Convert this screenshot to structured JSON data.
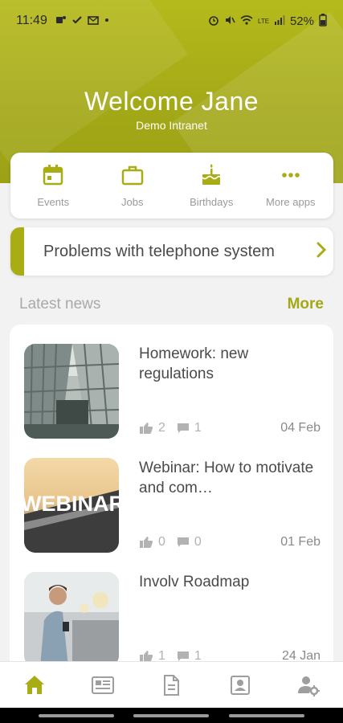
{
  "status_bar": {
    "time": "11:49",
    "battery": "52%",
    "left_icons": [
      "teams-icon",
      "check-icon",
      "outlook-icon",
      "dot-icon"
    ],
    "right_icons": [
      "alarm-icon",
      "mute-icon",
      "wifi-icon",
      "volte-icon",
      "signal-icon",
      "battery-icon"
    ]
  },
  "header": {
    "title": "Welcome Jane",
    "subtitle": "Demo Intranet",
    "accent_color": "#a8ad15"
  },
  "quick_apps": [
    {
      "label": "Events",
      "icon": "calendar-icon"
    },
    {
      "label": "Jobs",
      "icon": "briefcase-icon"
    },
    {
      "label": "Birthdays",
      "icon": "cake-icon"
    },
    {
      "label": "More apps",
      "icon": "more-dots-icon"
    }
  ],
  "banner": {
    "text": "Problems with telephone system",
    "icon": "chevron-right-icon"
  },
  "news_section": {
    "title": "Latest news",
    "more_label": "More"
  },
  "news": [
    {
      "title": "Homework: new regulations",
      "likes": "2",
      "comments": "1",
      "date": "04 Feb",
      "image": "glass-building-photo"
    },
    {
      "title": "Webinar: How to motivate and com…",
      "likes": "0",
      "comments": "0",
      "date": "01 Feb",
      "image": "webinar-photo",
      "image_text": "WEBINAR"
    },
    {
      "title": "Involv Roadmap",
      "likes": "1",
      "comments": "1",
      "date": "24 Jan",
      "image": "man-with-phone-photo"
    }
  ],
  "bottom_nav": [
    {
      "icon": "home-icon",
      "active": true
    },
    {
      "icon": "news-icon",
      "active": false
    },
    {
      "icon": "document-icon",
      "active": false
    },
    {
      "icon": "contact-card-icon",
      "active": false
    },
    {
      "icon": "user-settings-icon",
      "active": false
    }
  ]
}
